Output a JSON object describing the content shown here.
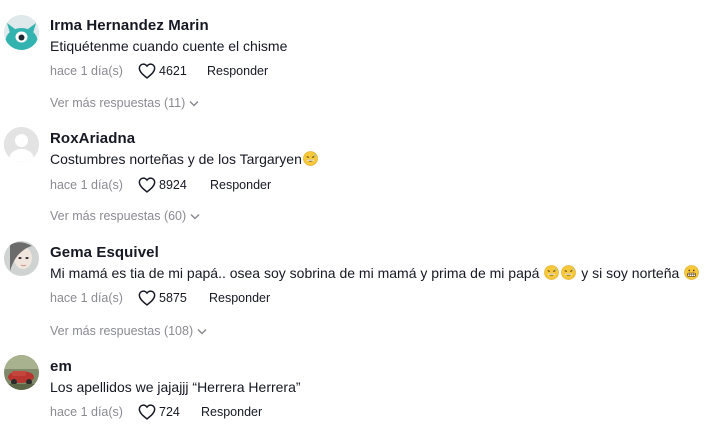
{
  "comments": [
    {
      "username": "Irma Hernandez Marin",
      "text": "Etiquétenme cuando cuente el chisme",
      "time": "hace 1 día(s)",
      "likes": "4621",
      "reply_label": "Responder",
      "more_replies": "Ver más respuestas (11)",
      "avatar_icon": "teal-creature-avatar"
    },
    {
      "username": "RoxAriadna",
      "text": "Costumbres norteñas y de los Targaryen",
      "time": "hace 1 día(s)",
      "likes": "8924",
      "reply_label": "Responder",
      "more_replies": "Ver más respuestas (60)",
      "avatar_icon": "default-user-avatar"
    },
    {
      "username": "Gema Esquivel",
      "text_part1": "Mi mamá es tia de mi papá.. osea soy sobrina de mi mamá y prima de mi papá",
      "text_part2": "y si soy norteña",
      "time": "hace 1 día(s)",
      "likes": "5875",
      "reply_label": "Responder",
      "more_replies": "Ver más respuestas (108)",
      "avatar_icon": "photo-avatar"
    },
    {
      "username": "em",
      "text": "Los apellidos we jajajjj “Herrera Herrera”",
      "time": "hace 1 día(s)",
      "likes": "724",
      "reply_label": "Responder",
      "avatar_icon": "photo-avatar"
    }
  ],
  "colors": {
    "text": "#161823",
    "muted": "#8a8b91",
    "avatar_teal": "#33b3b0",
    "default_avatar": "#e3e3e4"
  }
}
